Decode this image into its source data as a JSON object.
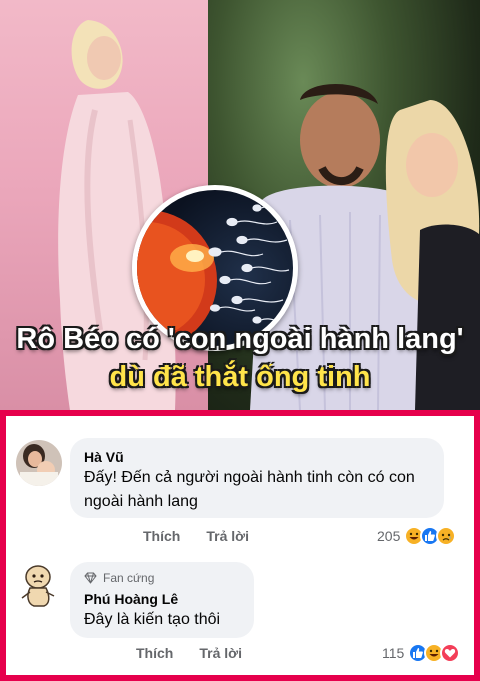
{
  "headline": {
    "line1": "Rô Béo có 'con ngoài hành lang'",
    "line2": "dù đã thắt ống tinh"
  },
  "comments": [
    {
      "author": "Hà Vũ",
      "text": "Đấy! Đến cả người ngoài hành tinh còn có con ngoài hành lang",
      "like_label": "Thích",
      "reply_label": "Trả lời",
      "reaction_count": "205",
      "reaction_icons": [
        "haha-icon",
        "like-icon",
        "sad-icon"
      ]
    },
    {
      "badge": "Fan cứng",
      "author": "Phú Hoàng Lê",
      "text": "Đây là kiến tạo thôi",
      "like_label": "Thích",
      "reply_label": "Trả lời",
      "reaction_count": "115",
      "reaction_icons": [
        "like-icon",
        "haha-icon",
        "love-icon"
      ]
    }
  ],
  "colors": {
    "frame": "#e6004c",
    "bubble": "#f0f2f5",
    "like_blue": "#1877f2",
    "haha_yellow": "#f7b125",
    "love_red": "#f33e58"
  }
}
